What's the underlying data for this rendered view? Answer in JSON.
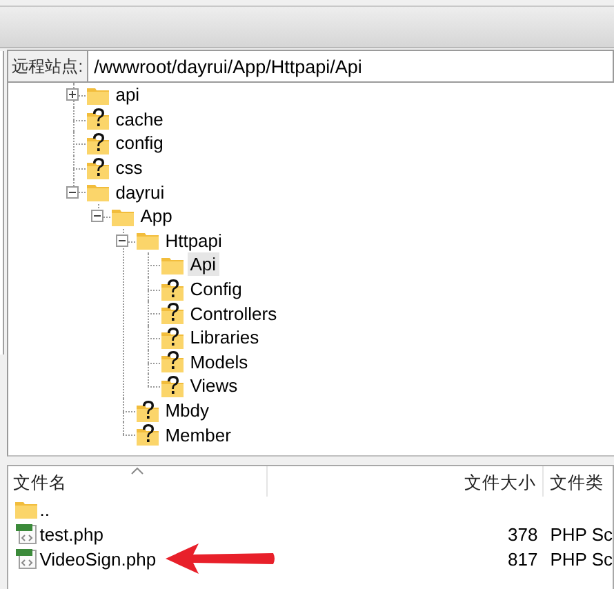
{
  "address_bar": {
    "label": "远程站点:",
    "value": "/wwwroot/dayrui/App/Httpapi/Api"
  },
  "tree": [
    {
      "name": "api",
      "kind": "folder",
      "expanded": false,
      "selected": false
    },
    {
      "name": "cache",
      "kind": "unknown",
      "selected": false
    },
    {
      "name": "config",
      "kind": "unknown",
      "selected": false
    },
    {
      "name": "css",
      "kind": "unknown",
      "selected": false
    },
    {
      "name": "dayrui",
      "kind": "folder",
      "expanded": true,
      "selected": false,
      "children": [
        {
          "name": "App",
          "kind": "folder",
          "expanded": true,
          "selected": false,
          "children": [
            {
              "name": "Httpapi",
              "kind": "folder",
              "expanded": true,
              "selected": false,
              "children": [
                {
                  "name": "Api",
                  "kind": "folder",
                  "selected": true
                },
                {
                  "name": "Config",
                  "kind": "unknown",
                  "selected": false
                },
                {
                  "name": "Controllers",
                  "kind": "unknown",
                  "selected": false
                },
                {
                  "name": "Libraries",
                  "kind": "unknown",
                  "selected": false
                },
                {
                  "name": "Models",
                  "kind": "unknown",
                  "selected": false
                },
                {
                  "name": "Views",
                  "kind": "unknown",
                  "selected": false
                }
              ]
            },
            {
              "name": "Mbdy",
              "kind": "unknown",
              "selected": false
            },
            {
              "name": "Member",
              "kind": "unknown",
              "selected": false
            }
          ]
        }
      ]
    }
  ],
  "file_list": {
    "columns": [
      {
        "label": "文件名",
        "sorted": true
      },
      {
        "label": "文件大小",
        "sorted": false
      },
      {
        "label": "文件类",
        "sorted": false
      }
    ],
    "rows": [
      {
        "kind": "folder",
        "name": "..",
        "marked": false
      },
      {
        "kind": "php",
        "name": "test.php",
        "size": "378",
        "type": "PHP Sc",
        "marked": false
      },
      {
        "kind": "php",
        "name": "VideoSign.php",
        "size": "817",
        "type": "PHP Sc",
        "marked": true
      }
    ]
  }
}
